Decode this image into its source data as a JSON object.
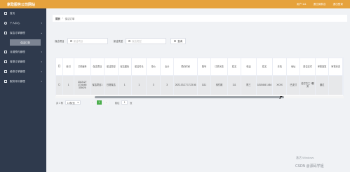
{
  "header": {
    "app_title": "家政服务公司网站",
    "user_label": "用户 111",
    "back_home": "退出到前台",
    "logout": "退出登录"
  },
  "sidebar": {
    "items": [
      {
        "label": "首页",
        "icon": "home-icon"
      },
      {
        "label": "个人中心",
        "icon": "user-icon"
      },
      {
        "label": "保洁订单管理",
        "icon": "box-icon"
      },
      {
        "label": "月嫂预约管理",
        "icon": "box-icon"
      },
      {
        "label": "育婴订单管理",
        "icon": "box-icon"
      },
      {
        "label": "维修订单管理",
        "icon": "box-icon"
      },
      {
        "label": "服务评价管理",
        "icon": "box-icon"
      }
    ],
    "submenu_active": "保洁订单"
  },
  "breadcrumb": {
    "root": "首页",
    "separator": "/",
    "current": "保洁订单"
  },
  "filter": {
    "field1_label": "保洁项目",
    "field1_placeholder": "保洁项目",
    "field2_label": "保洁类型",
    "field2_placeholder": "保洁类型",
    "search_label": "查询"
  },
  "table": {
    "columns": [
      "索引",
      "订单编号",
      "保洁项目",
      "保洁类型",
      "保洁图标",
      "保洁时长",
      "单价",
      "合计",
      "预约时间",
      "账号",
      "订单状态",
      "姓名",
      "电话",
      "姓名",
      "手机",
      "地址",
      "是否支付",
      "审核回复",
      "审核状态"
    ],
    "rows": [
      {
        "cells": [
          "1",
          "2022127 1726465 326626",
          "保洁项目1",
          "日常保洁",
          "1",
          "1",
          "3",
          "3",
          "2022-03-27 17:23:36",
          "1111",
          "待付款",
          "111",
          "陈三",
          "1815454 1454",
          "XXXX",
          "已支付",
          "信付方三 3服务",
          "通过"
        ]
      }
    ],
    "scroll_position": 0.16
  },
  "pagination": {
    "total": "共 1 条",
    "page_size": "10条/页",
    "prev": "‹",
    "current_page": "1",
    "next": "›",
    "goto_prefix": "前往",
    "goto_value": "1",
    "goto_suffix": "页"
  },
  "watermark": {
    "activate": "激活 Windows",
    "csdn": "CSDN @源码学姐"
  },
  "colors": {
    "topbar": "#e6a23c",
    "sidebar": "#2f3a4d",
    "accent": "#4cae4c"
  }
}
